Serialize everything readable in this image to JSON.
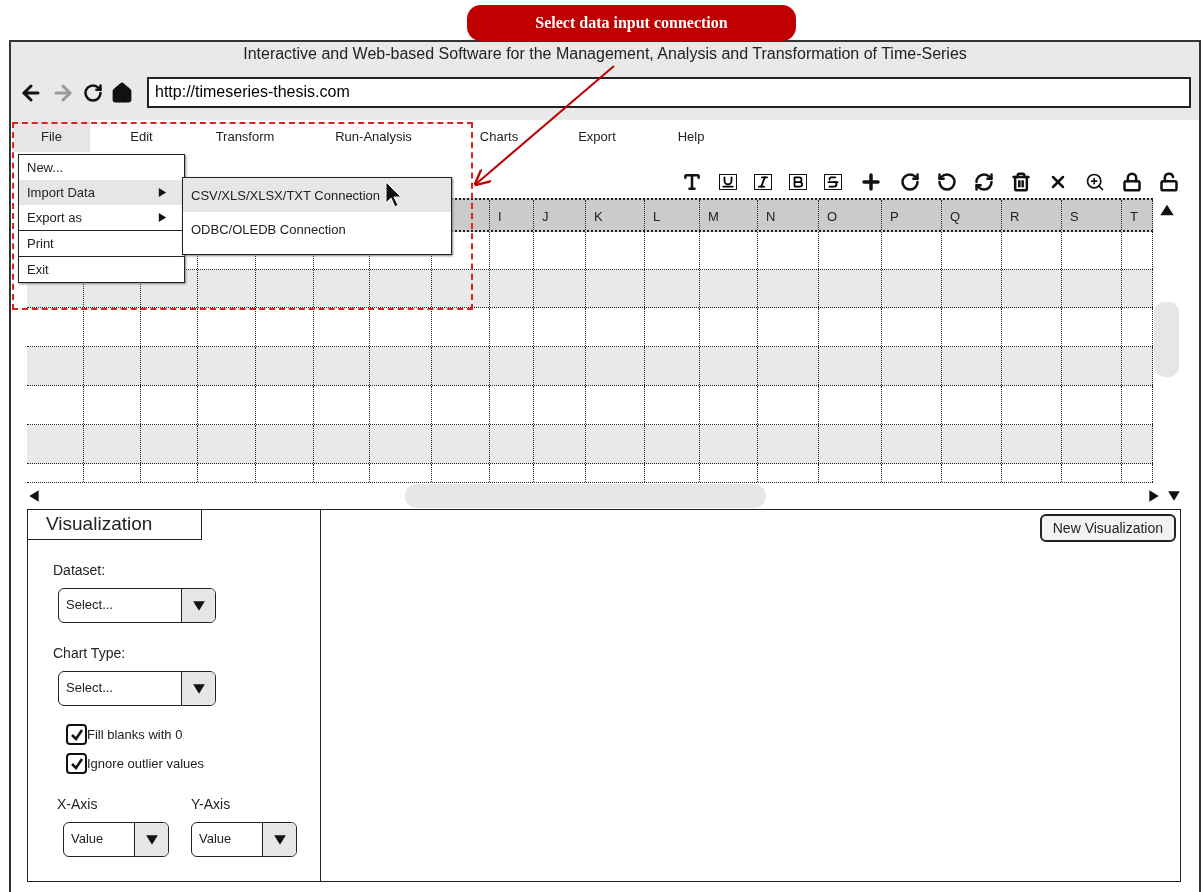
{
  "annotation": {
    "text": "Select data input connection"
  },
  "window": {
    "title": "Interactive and Web-based Software for the Management, Analysis and Transformation of Time-Series"
  },
  "address_bar": {
    "value": "http://timeseries-thesis.com"
  },
  "menubar": [
    {
      "label": "File",
      "selected": true
    },
    {
      "label": "Edit",
      "selected": false
    },
    {
      "label": "Transform",
      "selected": false
    },
    {
      "label": "Run-Analysis",
      "selected": false
    },
    {
      "label": "Charts",
      "selected": false
    },
    {
      "label": "Export",
      "selected": false
    },
    {
      "label": "Help",
      "selected": false
    }
  ],
  "file_menu": [
    [
      {
        "label": "New...",
        "submenu": false,
        "selected": false
      },
      {
        "label": "Import Data",
        "submenu": true,
        "selected": true
      },
      {
        "label": "Export as",
        "submenu": true,
        "selected": false
      }
    ],
    [
      {
        "label": "Print",
        "submenu": false,
        "selected": false
      }
    ],
    [
      {
        "label": "Exit",
        "submenu": false,
        "selected": false
      }
    ]
  ],
  "import_submenu": [
    {
      "label": "CSV/XLS/XLSX/TXT Connection",
      "selected": true
    },
    {
      "label": "ODBC/OLEDB Connection",
      "selected": false
    }
  ],
  "grid": {
    "columns": [
      "I",
      "J",
      "K",
      "L",
      "M",
      "N",
      "O",
      "P",
      "Q",
      "R",
      "S",
      "T"
    ]
  },
  "visualization": {
    "tab": "Visualization",
    "dataset": {
      "label": "Dataset:",
      "value": "Select..."
    },
    "chart_type": {
      "label": "Chart Type:",
      "value": "Select..."
    },
    "options": [
      {
        "label": "Fill blanks with 0",
        "checked": true
      },
      {
        "label": "Ignore outlier values",
        "checked": true
      }
    ],
    "x_axis": {
      "label": "X-Axis",
      "value": "Value"
    },
    "y_axis": {
      "label": "Y-Axis",
      "value": "Value"
    },
    "new_button": "New Visualization"
  }
}
